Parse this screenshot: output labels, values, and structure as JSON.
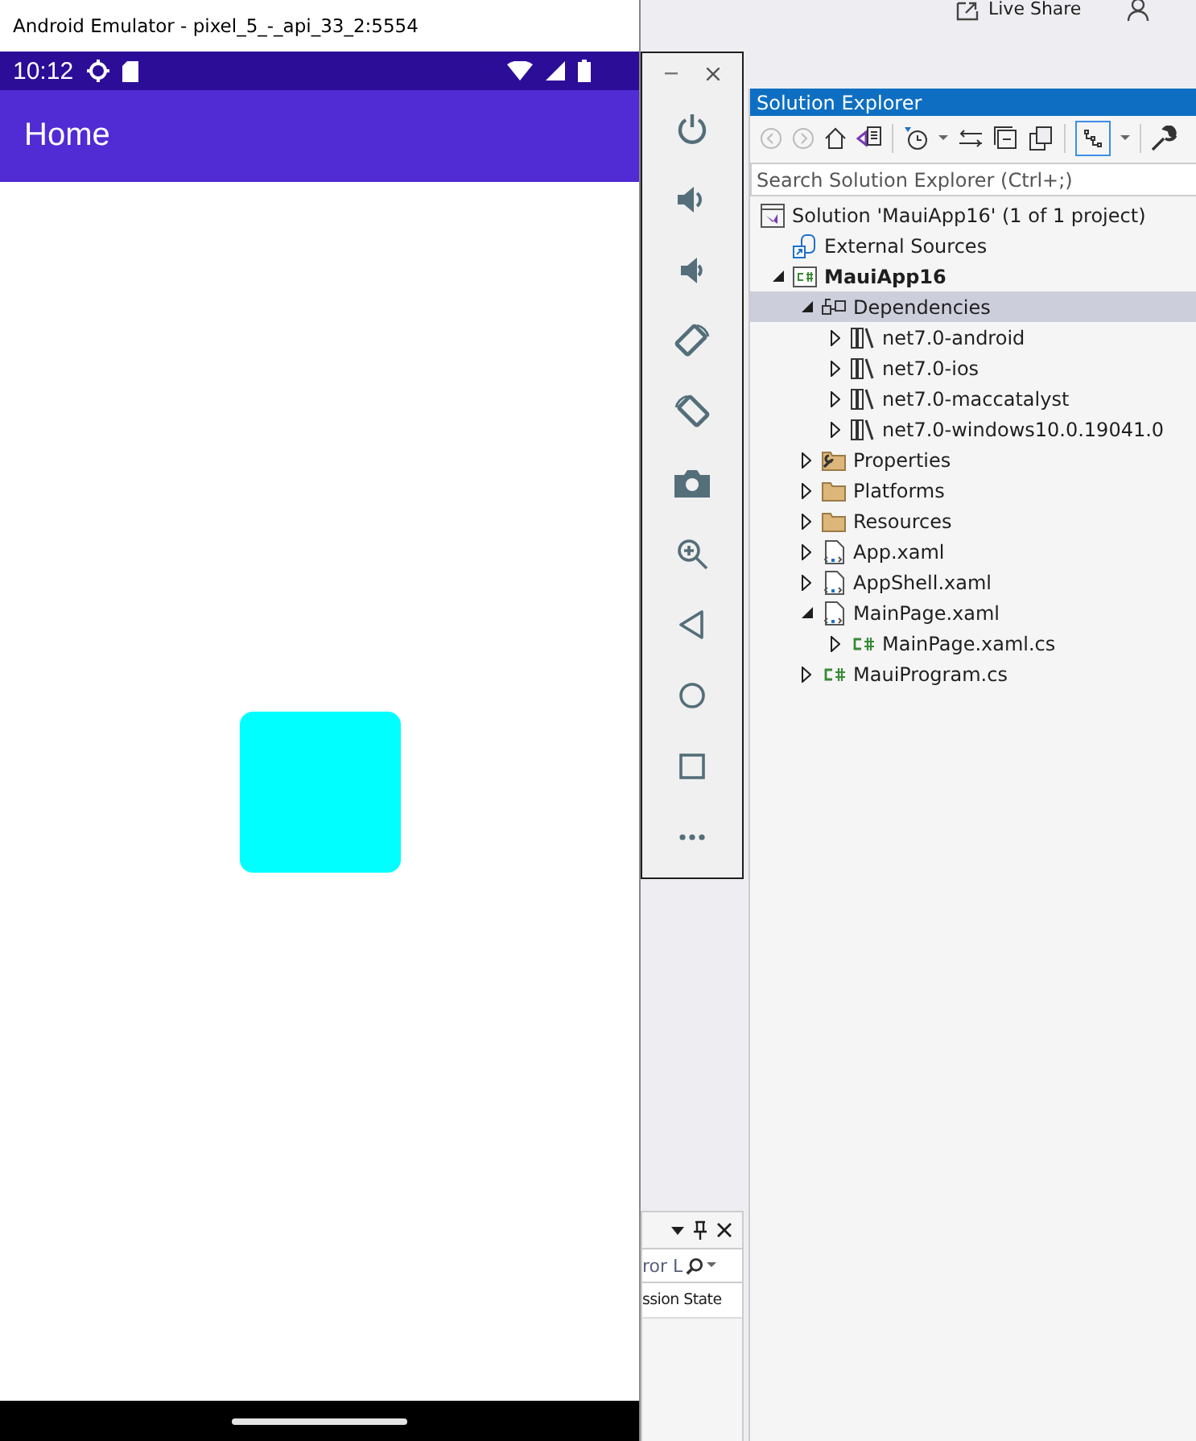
{
  "live_share": {
    "label": "Live Share"
  },
  "emulator": {
    "window": {
      "title": "Android Emulator - pixel_5_-_api_33_2:5554"
    },
    "status_bar": {
      "time": "10:12"
    },
    "app_bar": {
      "title": "Home"
    }
  },
  "emulator_controls": [
    {
      "kind": "power"
    },
    {
      "kind": "volume-up"
    },
    {
      "kind": "volume-down"
    },
    {
      "kind": "rotate-left"
    },
    {
      "kind": "rotate-right"
    },
    {
      "kind": "camera"
    },
    {
      "kind": "zoom"
    },
    {
      "kind": "back"
    },
    {
      "kind": "home"
    },
    {
      "kind": "overview"
    },
    {
      "kind": "more"
    }
  ],
  "solution_explorer": {
    "title": "Solution Explorer",
    "search": {
      "placeholder": "Search Solution Explorer (Ctrl+;)"
    },
    "tree": {
      "label": "Solution 'MauiApp16' (1 of 1 project)",
      "kind": "solution",
      "selected": false,
      "children": [
        {
          "label": "External Sources",
          "kind": "external",
          "selected": false
        },
        {
          "label": "MauiApp16",
          "kind": "project",
          "selected": false,
          "expanded": true,
          "children": [
            {
              "label": "Dependencies",
              "kind": "dependencies",
              "selected": true,
              "expanded": true,
              "children": [
                {
                  "label": "net7.0-android",
                  "kind": "framework",
                  "selected": false,
                  "expanded": false
                },
                {
                  "label": "net7.0-ios",
                  "kind": "framework",
                  "selected": false,
                  "expanded": false
                },
                {
                  "label": "net7.0-maccatalyst",
                  "kind": "framework",
                  "selected": false,
                  "expanded": false
                },
                {
                  "label": "net7.0-windows10.0.19041.0",
                  "kind": "framework",
                  "selected": false,
                  "expanded": false
                }
              ]
            },
            {
              "label": "Properties",
              "kind": "properties",
              "selected": false,
              "expanded": false
            },
            {
              "label": "Platforms",
              "kind": "folder",
              "selected": false,
              "expanded": false
            },
            {
              "label": "Resources",
              "kind": "folder",
              "selected": false,
              "expanded": false
            },
            {
              "label": "App.xaml",
              "kind": "xaml",
              "selected": false,
              "expanded": false
            },
            {
              "label": "AppShell.xaml",
              "kind": "xaml",
              "selected": false,
              "expanded": false
            },
            {
              "label": "MainPage.xaml",
              "kind": "xaml",
              "selected": false,
              "expanded": true,
              "children": [
                {
                  "label": "MainPage.xaml.cs",
                  "kind": "csharp",
                  "selected": false,
                  "expanded": false
                }
              ]
            },
            {
              "label": "MauiProgram.cs",
              "kind": "csharp",
              "selected": false,
              "expanded": false
            }
          ]
        }
      ]
    }
  },
  "bottom_panel": {
    "search": {
      "placeholder": "ror L"
    },
    "column_header": "ssion State"
  }
}
